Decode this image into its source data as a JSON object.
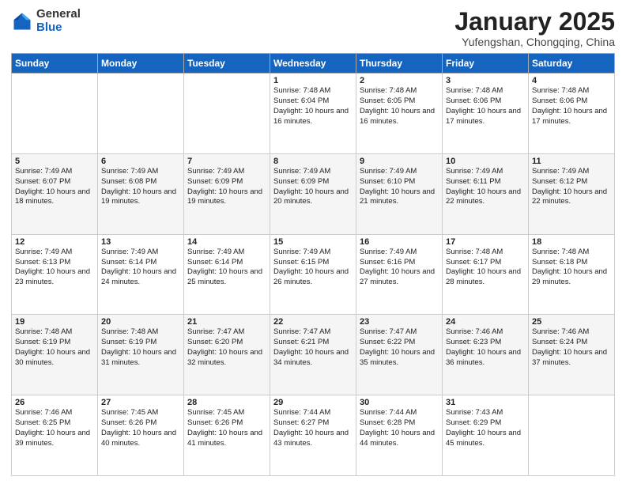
{
  "header": {
    "logo_general": "General",
    "logo_blue": "Blue",
    "month_title": "January 2025",
    "subtitle": "Yufengshan, Chongqing, China"
  },
  "days_of_week": [
    "Sunday",
    "Monday",
    "Tuesday",
    "Wednesday",
    "Thursday",
    "Friday",
    "Saturday"
  ],
  "weeks": [
    [
      {
        "day": "",
        "sunrise": "",
        "sunset": "",
        "daylight": ""
      },
      {
        "day": "",
        "sunrise": "",
        "sunset": "",
        "daylight": ""
      },
      {
        "day": "",
        "sunrise": "",
        "sunset": "",
        "daylight": ""
      },
      {
        "day": "1",
        "sunrise": "7:48 AM",
        "sunset": "6:04 PM",
        "daylight": "10 hours and 16 minutes."
      },
      {
        "day": "2",
        "sunrise": "7:48 AM",
        "sunset": "6:05 PM",
        "daylight": "10 hours and 16 minutes."
      },
      {
        "day": "3",
        "sunrise": "7:48 AM",
        "sunset": "6:06 PM",
        "daylight": "10 hours and 17 minutes."
      },
      {
        "day": "4",
        "sunrise": "7:48 AM",
        "sunset": "6:06 PM",
        "daylight": "10 hours and 17 minutes."
      }
    ],
    [
      {
        "day": "5",
        "sunrise": "7:49 AM",
        "sunset": "6:07 PM",
        "daylight": "10 hours and 18 minutes."
      },
      {
        "day": "6",
        "sunrise": "7:49 AM",
        "sunset": "6:08 PM",
        "daylight": "10 hours and 19 minutes."
      },
      {
        "day": "7",
        "sunrise": "7:49 AM",
        "sunset": "6:09 PM",
        "daylight": "10 hours and 19 minutes."
      },
      {
        "day": "8",
        "sunrise": "7:49 AM",
        "sunset": "6:09 PM",
        "daylight": "10 hours and 20 minutes."
      },
      {
        "day": "9",
        "sunrise": "7:49 AM",
        "sunset": "6:10 PM",
        "daylight": "10 hours and 21 minutes."
      },
      {
        "day": "10",
        "sunrise": "7:49 AM",
        "sunset": "6:11 PM",
        "daylight": "10 hours and 22 minutes."
      },
      {
        "day": "11",
        "sunrise": "7:49 AM",
        "sunset": "6:12 PM",
        "daylight": "10 hours and 22 minutes."
      }
    ],
    [
      {
        "day": "12",
        "sunrise": "7:49 AM",
        "sunset": "6:13 PM",
        "daylight": "10 hours and 23 minutes."
      },
      {
        "day": "13",
        "sunrise": "7:49 AM",
        "sunset": "6:14 PM",
        "daylight": "10 hours and 24 minutes."
      },
      {
        "day": "14",
        "sunrise": "7:49 AM",
        "sunset": "6:14 PM",
        "daylight": "10 hours and 25 minutes."
      },
      {
        "day": "15",
        "sunrise": "7:49 AM",
        "sunset": "6:15 PM",
        "daylight": "10 hours and 26 minutes."
      },
      {
        "day": "16",
        "sunrise": "7:49 AM",
        "sunset": "6:16 PM",
        "daylight": "10 hours and 27 minutes."
      },
      {
        "day": "17",
        "sunrise": "7:48 AM",
        "sunset": "6:17 PM",
        "daylight": "10 hours and 28 minutes."
      },
      {
        "day": "18",
        "sunrise": "7:48 AM",
        "sunset": "6:18 PM",
        "daylight": "10 hours and 29 minutes."
      }
    ],
    [
      {
        "day": "19",
        "sunrise": "7:48 AM",
        "sunset": "6:19 PM",
        "daylight": "10 hours and 30 minutes."
      },
      {
        "day": "20",
        "sunrise": "7:48 AM",
        "sunset": "6:19 PM",
        "daylight": "10 hours and 31 minutes."
      },
      {
        "day": "21",
        "sunrise": "7:47 AM",
        "sunset": "6:20 PM",
        "daylight": "10 hours and 32 minutes."
      },
      {
        "day": "22",
        "sunrise": "7:47 AM",
        "sunset": "6:21 PM",
        "daylight": "10 hours and 34 minutes."
      },
      {
        "day": "23",
        "sunrise": "7:47 AM",
        "sunset": "6:22 PM",
        "daylight": "10 hours and 35 minutes."
      },
      {
        "day": "24",
        "sunrise": "7:46 AM",
        "sunset": "6:23 PM",
        "daylight": "10 hours and 36 minutes."
      },
      {
        "day": "25",
        "sunrise": "7:46 AM",
        "sunset": "6:24 PM",
        "daylight": "10 hours and 37 minutes."
      }
    ],
    [
      {
        "day": "26",
        "sunrise": "7:46 AM",
        "sunset": "6:25 PM",
        "daylight": "10 hours and 39 minutes."
      },
      {
        "day": "27",
        "sunrise": "7:45 AM",
        "sunset": "6:26 PM",
        "daylight": "10 hours and 40 minutes."
      },
      {
        "day": "28",
        "sunrise": "7:45 AM",
        "sunset": "6:26 PM",
        "daylight": "10 hours and 41 minutes."
      },
      {
        "day": "29",
        "sunrise": "7:44 AM",
        "sunset": "6:27 PM",
        "daylight": "10 hours and 43 minutes."
      },
      {
        "day": "30",
        "sunrise": "7:44 AM",
        "sunset": "6:28 PM",
        "daylight": "10 hours and 44 minutes."
      },
      {
        "day": "31",
        "sunrise": "7:43 AM",
        "sunset": "6:29 PM",
        "daylight": "10 hours and 45 minutes."
      },
      {
        "day": "",
        "sunrise": "",
        "sunset": "",
        "daylight": ""
      }
    ]
  ]
}
